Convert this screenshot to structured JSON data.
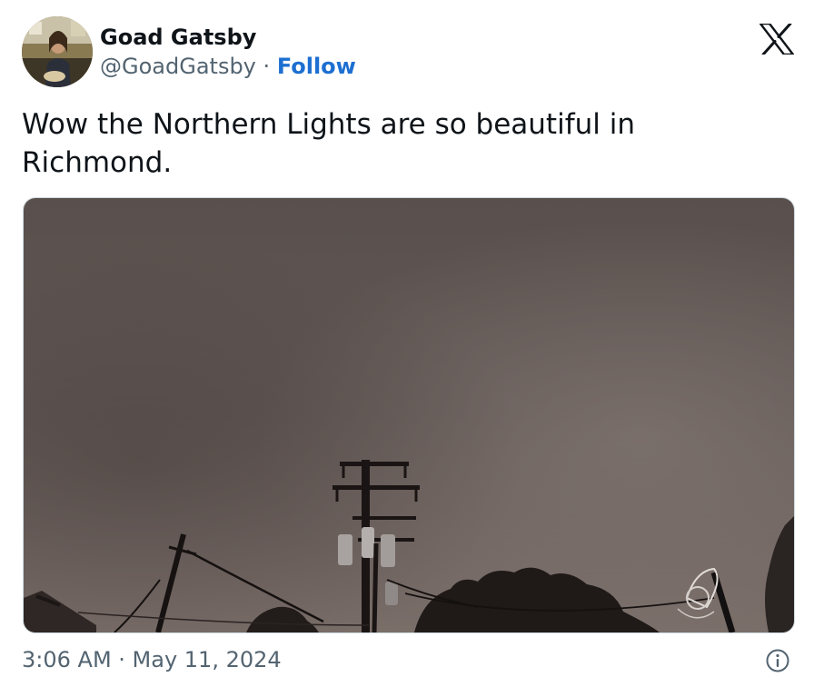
{
  "tweet": {
    "author": {
      "display_name": "Goad Gatsby",
      "handle": "@GoadGatsby",
      "separator": "·",
      "follow_label": "Follow",
      "avatar_icon": "profile-photo"
    },
    "platform_icon": "x-logo-icon",
    "text": "Wow the Northern Lights are so beautiful in\nRichmond.",
    "media": {
      "type": "photo",
      "description_icon": "night-sky-photo"
    },
    "timestamp": "3:06 AM · May 11, 2024",
    "info_icon": "info-icon"
  },
  "colors": {
    "text_primary": "#0f1419",
    "text_secondary": "#536471",
    "link": "#1d6fd1",
    "sky": "#5e5551"
  }
}
